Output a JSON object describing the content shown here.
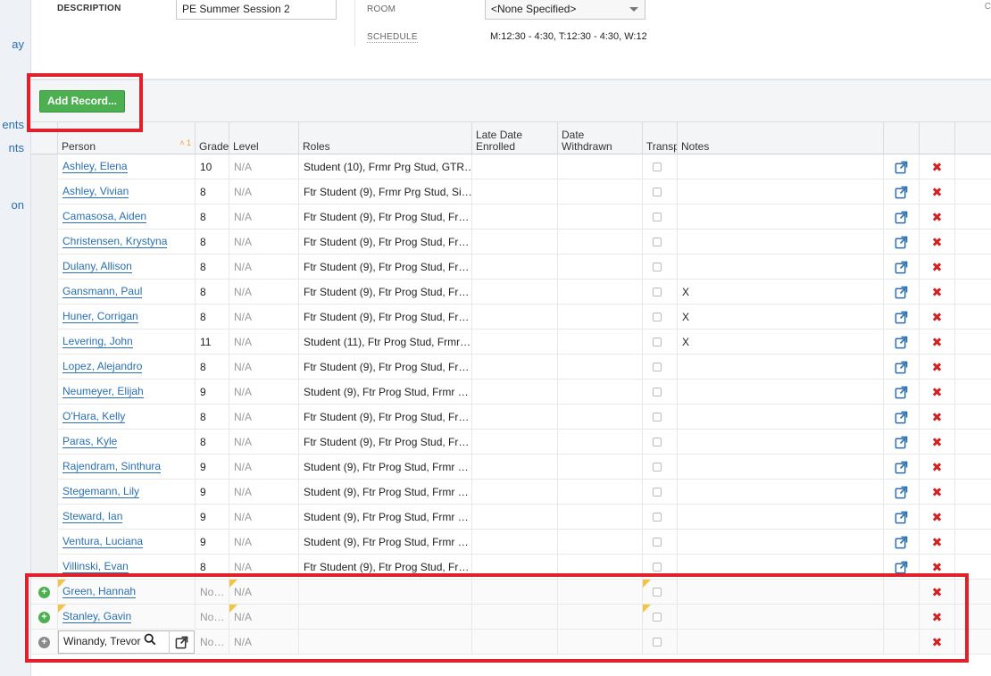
{
  "nav": {
    "frag1": "ay",
    "frag2": "ents",
    "frag3": "nts",
    "frag4": "on"
  },
  "form": {
    "description_label": "DESCRIPTION",
    "description_value": "PE Summer Session 2",
    "room_label": "ROOM",
    "room_value": "<None Specified>",
    "schedule_label": "SCHEDULE",
    "schedule_value": "M:12:30 - 4:30, T:12:30 - 4:30, W:12",
    "right_fragment": "C"
  },
  "toolbar": {
    "add_record_label": "Add Record..."
  },
  "columns": {
    "person": "Person",
    "sort_indicator": "˄ 1",
    "grade": "Grade",
    "level": "Level",
    "roles": "Roles",
    "late_date_1": "Late Date",
    "late_date_2": "Enrolled",
    "date_withdrawn_1": "Date",
    "date_withdrawn_2": "Withdrawn",
    "transp": "Transp",
    "notes": "Notes"
  },
  "rows": [
    {
      "person": "Ashley, Elena",
      "grade": "10",
      "level": "N/A",
      "roles": "Student (10), Frmr Prg Stud, GTR…",
      "notes": ""
    },
    {
      "person": "Ashley, Vivian",
      "grade": "8",
      "level": "N/A",
      "roles": "Ftr Student (9), Frmr Prg Stud, Si…",
      "notes": ""
    },
    {
      "person": "Camasosa, Aiden",
      "grade": "8",
      "level": "N/A",
      "roles": "Ftr Student (9), Ftr Prog Stud, Fr…",
      "notes": ""
    },
    {
      "person": "Christensen, Krystyna",
      "grade": "8",
      "level": "N/A",
      "roles": "Ftr Student (9), Ftr Prog Stud, Fr…",
      "notes": ""
    },
    {
      "person": "Dulany, Allison",
      "grade": "8",
      "level": "N/A",
      "roles": "Ftr Student (9), Ftr Prog Stud, Fr…",
      "notes": ""
    },
    {
      "person": "Gansmann, Paul",
      "grade": "8",
      "level": "N/A",
      "roles": "Ftr Student (9), Ftr Prog Stud, Fr…",
      "notes": "X"
    },
    {
      "person": "Huner, Corrigan",
      "grade": "8",
      "level": "N/A",
      "roles": "Ftr Student (9), Ftr Prog Stud, Fr…",
      "notes": "X"
    },
    {
      "person": "Levering, John",
      "grade": "11",
      "level": "N/A",
      "roles": "Student (11), Ftr Prog Stud, Frmr…",
      "notes": "X"
    },
    {
      "person": "Lopez, Alejandro",
      "grade": "8",
      "level": "N/A",
      "roles": "Ftr Student (9), Ftr Prog Stud, Fr…",
      "notes": ""
    },
    {
      "person": "Neumeyer, Elijah",
      "grade": "9",
      "level": "N/A",
      "roles": "Student (9), Ftr Prog Stud, Frmr …",
      "notes": ""
    },
    {
      "person": "O'Hara, Kelly",
      "grade": "8",
      "level": "N/A",
      "roles": "Ftr Student (9), Ftr Prog Stud, Fr…",
      "notes": ""
    },
    {
      "person": "Paras, Kyle",
      "grade": "8",
      "level": "N/A",
      "roles": "Ftr Student (9), Ftr Prog Stud, Fr…",
      "notes": ""
    },
    {
      "person": "Rajendram, Sinthura",
      "grade": "9",
      "level": "N/A",
      "roles": "Student (9), Ftr Prog Stud, Frmr …",
      "notes": ""
    },
    {
      "person": "Stegemann, Lily",
      "grade": "9",
      "level": "N/A",
      "roles": "Student (9), Ftr Prog Stud, Frmr …",
      "notes": ""
    },
    {
      "person": "Steward, Ian",
      "grade": "9",
      "level": "N/A",
      "roles": "Student (9), Ftr Prog Stud, Frmr …",
      "notes": ""
    },
    {
      "person": "Ventura, Luciana",
      "grade": "9",
      "level": "N/A",
      "roles": "Student (9), Ftr Prog Stud, Frmr …",
      "notes": ""
    },
    {
      "person": "Villinski, Evan",
      "grade": "8",
      "level": "N/A",
      "roles": "Ftr Student (9), Ftr Prog Stud, Fr…",
      "notes": ""
    }
  ],
  "new_rows": [
    {
      "person": "Green, Hannah",
      "grade": "No…",
      "level": "N/A"
    },
    {
      "person": "Stanley, Gavin",
      "grade": "No…",
      "level": "N/A"
    }
  ],
  "edit_row": {
    "person_value": "Winandy, Trevor",
    "grade": "No…",
    "level": "N/A"
  },
  "colors": {
    "accent_green": "#4caf50",
    "link_blue": "#2a6fb0",
    "delete_red": "#d32020",
    "highlight_red": "#e0202a"
  }
}
